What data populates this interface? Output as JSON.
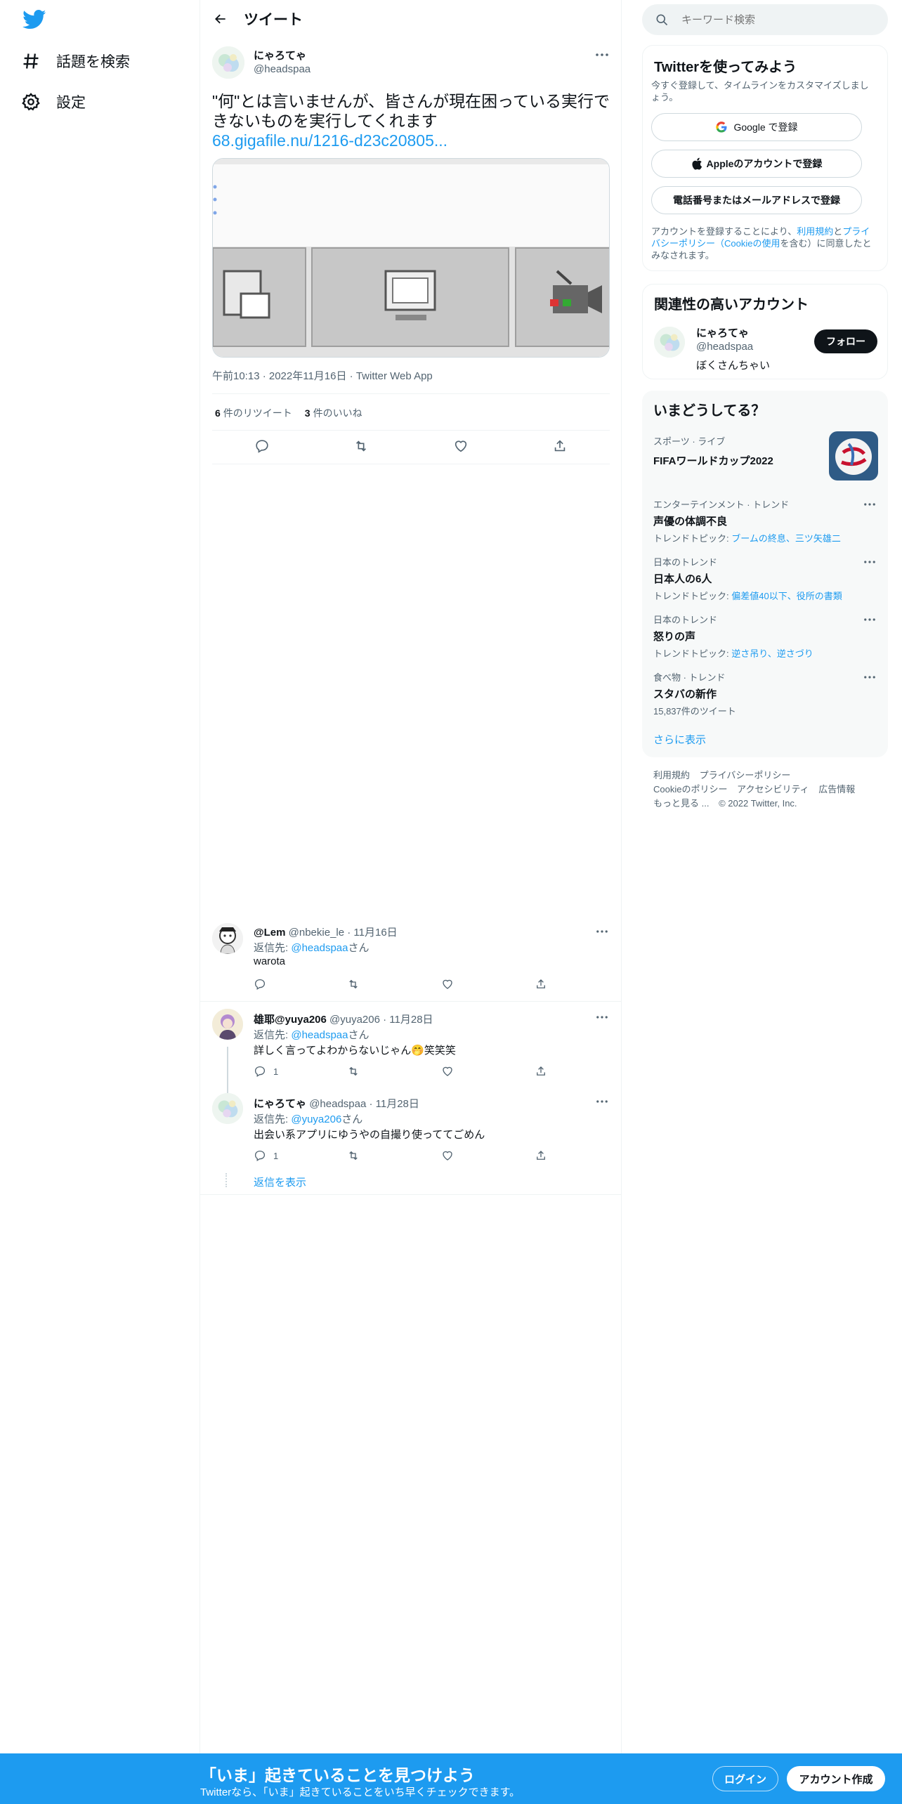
{
  "nav": {
    "items": [
      {
        "label": "話題を検索",
        "icon": "hashtag-icon"
      },
      {
        "label": "設定",
        "icon": "gear-icon"
      }
    ]
  },
  "header": {
    "title": "ツイート"
  },
  "tweet": {
    "name": "にゃろてゃ",
    "handle": "@headspaa",
    "text": "\"何\"とは言いませんが、皆さんが現在困っている実行できないものを実行してくれます",
    "link": "68.gigafile.nu/1216-d23c20805...",
    "meta": "午前10:13 · 2022年11月16日 · Twitter Web App",
    "retweets_count": "6",
    "retweets_label": "件のリツイート",
    "likes_count": "3",
    "likes_label": "件のいいね"
  },
  "replies": [
    {
      "name": "@Lem",
      "handle": "@nbekie_le",
      "date": "· 11月16日",
      "reply_to_prefix": "返信先: ",
      "reply_to": "@headspaa",
      "reply_to_suffix": "さん",
      "text": "warota",
      "reply_count": ""
    },
    {
      "name": "雄耶@yuya206",
      "handle": "@yuya206",
      "date": "· 11月28日",
      "reply_to_prefix": "返信先: ",
      "reply_to": "@headspaa",
      "reply_to_suffix": "さん",
      "text": "詳しく言ってよわからないじゃん🤭笑笑笑",
      "reply_count": "1"
    },
    {
      "name": "にゃろてゃ",
      "handle": "@headspaa",
      "date": "· 11月28日",
      "reply_to_prefix": "返信先: ",
      "reply_to": "@yuya206",
      "reply_to_suffix": "さん",
      "text": "出会い系アプリにゆうやの自撮り使っててごめん",
      "reply_count": "1"
    }
  ],
  "show_replies": "返信を表示",
  "search": {
    "placeholder": "キーワード検索"
  },
  "signup_card": {
    "title": "Twitterを使ってみよう",
    "desc": "今すぐ登録して、タイムラインをカスタマイズしましょう。",
    "google": "Google で登録",
    "apple": "Appleのアカウントで登録",
    "phone": "電話番号またはメールアドレスで登録",
    "legal_1": "アカウントを登録することにより、",
    "legal_terms": "利用規約",
    "legal_2": "と",
    "legal_privacy": "プライバシーポリシー（Cookieの使用",
    "legal_3": "を含む）に同意したとみなされます。"
  },
  "related": {
    "title": "関連性の高いアカウント",
    "name": "にゃろてゃ",
    "handle": "@headspaa",
    "bio": "ぼくさんちゃい",
    "follow": "フォロー"
  },
  "trends": {
    "title": "いまどうしてる？",
    "items": [
      {
        "category": "スポーツ · ライブ",
        "name": "FIFAワールドカップ2022",
        "sub_prefix": "",
        "sub_link": "",
        "count": ""
      },
      {
        "category": "エンターテインメント · トレンド",
        "name": "声優の体調不良",
        "sub_prefix": "トレンドトピック: ",
        "sub_link": "ブームの終息、三ツ矢雄二",
        "count": ""
      },
      {
        "category": "日本のトレンド",
        "name": "日本人の6人",
        "sub_prefix": "トレンドトピック: ",
        "sub_link": "偏差値40以下、役所の書類",
        "count": ""
      },
      {
        "category": "日本のトレンド",
        "name": "怒りの声",
        "sub_prefix": "トレンドトピック: ",
        "sub_link": "逆さ吊り、逆さづり",
        "count": ""
      },
      {
        "category": "食べ物 · トレンド",
        "name": "スタバの新作",
        "sub_prefix": "",
        "sub_link": "",
        "count": "15,837件のツイート"
      }
    ],
    "show_more": "さらに表示"
  },
  "footer": {
    "links": [
      "利用規約",
      "プライバシーポリシー",
      "Cookieのポリシー",
      "アクセシビリティ",
      "広告情報",
      "もっと見る ..."
    ],
    "copyright": "© 2022 Twitter, Inc."
  },
  "bottom_bar": {
    "title": "「いま」起きていることを見つけよう",
    "subtitle": "Twitterなら、「いま」起きていることをいち早くチェックできます。",
    "login": "ログイン",
    "signup": "アカウント作成"
  },
  "colors": {
    "accent": "#1d9bf0",
    "text": "#0f1419",
    "muted": "#536471"
  }
}
